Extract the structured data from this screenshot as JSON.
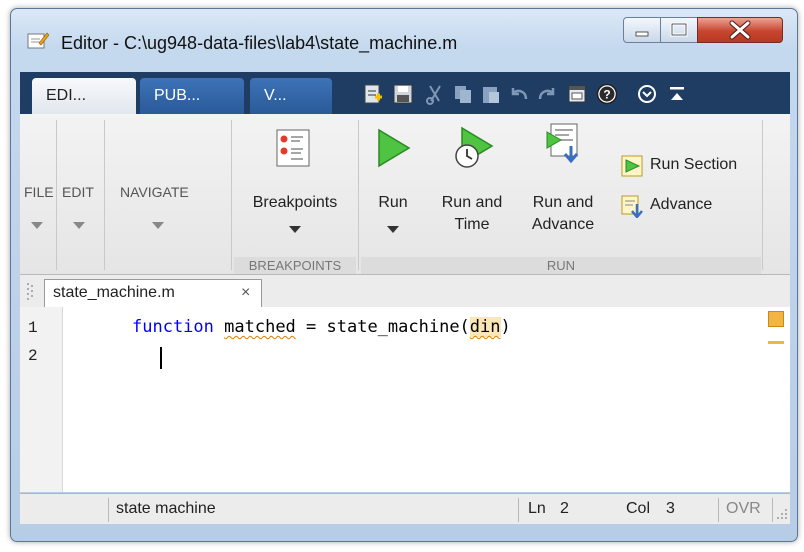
{
  "window": {
    "title": "Editor - C:\\ug948-data-files\\lab4\\state_machine.m"
  },
  "tabs": [
    {
      "label": "EDI..."
    },
    {
      "label": "PUB..."
    },
    {
      "label": "V..."
    }
  ],
  "ribbon": {
    "file_label": "FILE",
    "edit_label": "EDIT",
    "navigate_label": "NAVIGATE",
    "breakpoints_label": "Breakpoints",
    "breakpoints_group": "BREAKPOINTS",
    "run_label": "Run",
    "run_and_time_line1": "Run and",
    "run_and_time_line2": "Time",
    "run_and_advance_line1": "Run and",
    "run_and_advance_line2": "Advance",
    "run_section_label": "Run Section",
    "advance_label": "Advance",
    "run_group": "RUN"
  },
  "document": {
    "tab_name": "state_machine.m",
    "close_glyph": "×",
    "line_numbers": [
      "1",
      "2"
    ],
    "code_keyword": "function",
    "code_output": "matched",
    "code_middle": " = state_machine(",
    "code_arg": "din",
    "code_close": ")"
  },
  "status": {
    "function_name": "state machine",
    "line_label": "Ln",
    "line_value": "2",
    "col_label": "Col",
    "col_value": "3",
    "mode": "OVR"
  },
  "colors": {
    "accent_tabbar": "#1f3c63",
    "tab_blue": "#2f66a9",
    "keyword": "#0000ff",
    "warning": "#f3b443"
  }
}
